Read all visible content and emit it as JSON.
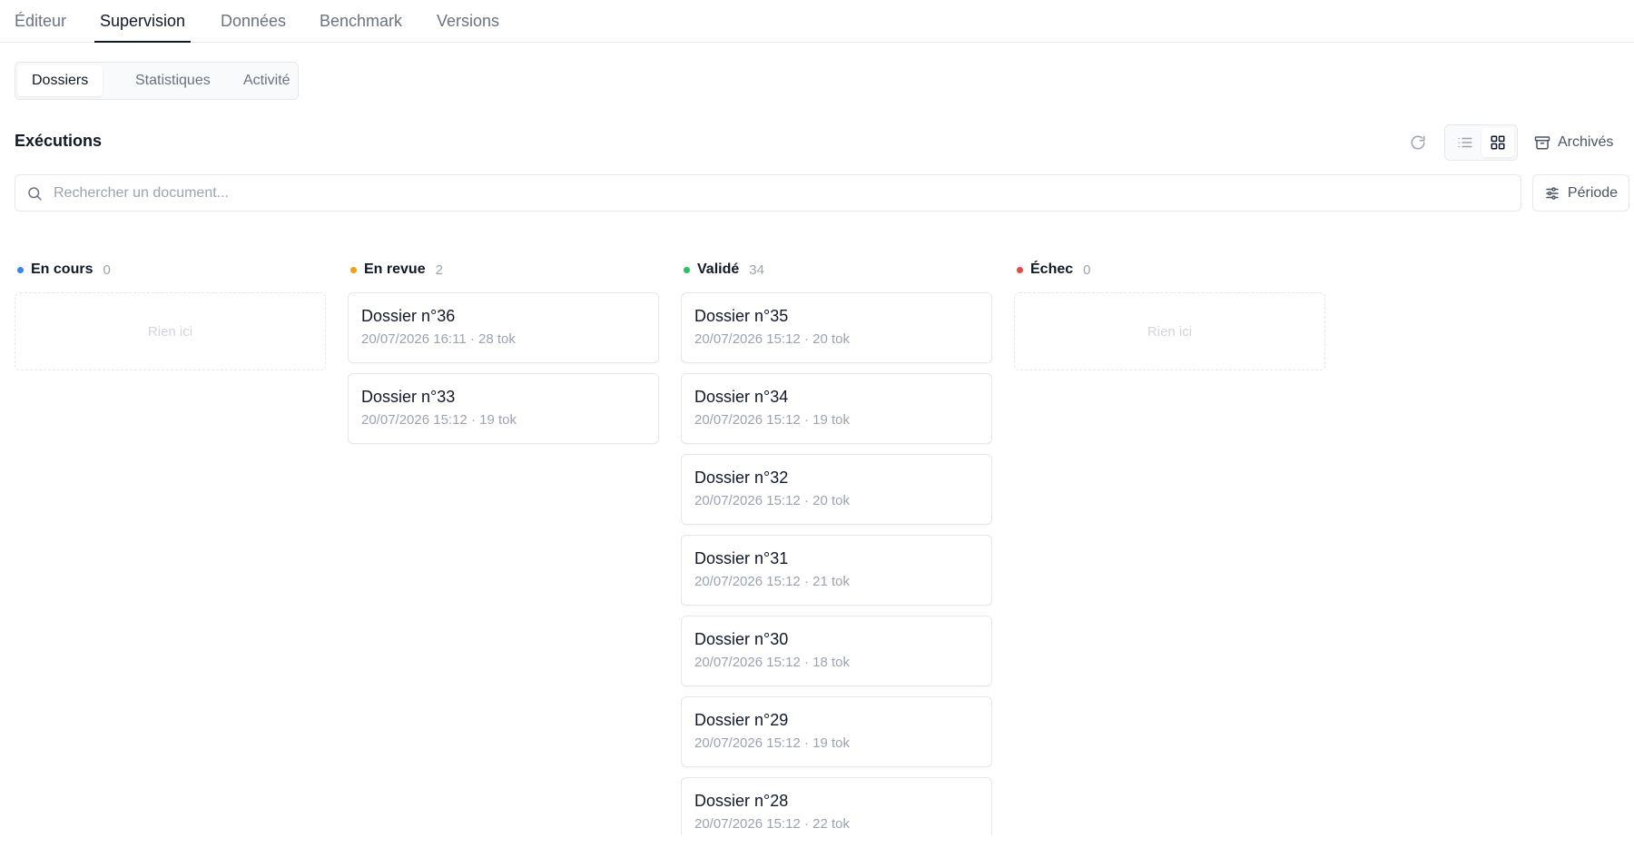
{
  "top_tabs": [
    "Éditeur",
    "Supervision",
    "Données",
    "Benchmark",
    "Versions"
  ],
  "active_top_tab": "Supervision",
  "sub_tabs": [
    "Dossiers",
    "Statistiques",
    "Activité"
  ],
  "active_sub_tab": "Dossiers",
  "section": {
    "title": "Exécutions",
    "archives_label": "Archivés",
    "view_mode": "grid"
  },
  "search": {
    "placeholder": "Rechercher un document...",
    "value": ""
  },
  "filter": {
    "periode_label": "Période"
  },
  "icons": {
    "refresh": "refresh-icon",
    "list_view": "list-icon",
    "grid_view": "grid-icon",
    "archive": "archive-icon",
    "search": "search-icon",
    "filter": "sliders-icon"
  },
  "columns": [
    {
      "title": "En cours",
      "count": "0",
      "color": "#3b82f6",
      "empty_label": "Rien ici",
      "cards": []
    },
    {
      "title": "En revue",
      "count": "2",
      "color": "#f59e0b",
      "empty_label": "",
      "cards": [
        {
          "title": "Dossier n°36",
          "meta": "20/07/2026 16:11 · 28 tok"
        },
        {
          "title": "Dossier n°33",
          "meta": "20/07/2026 15:12 · 19 tok"
        }
      ]
    },
    {
      "title": "Validé",
      "count": "34",
      "color": "#22c55e",
      "empty_label": "",
      "cards": [
        {
          "title": "Dossier n°35",
          "meta": "20/07/2026 15:12 · 20 tok"
        },
        {
          "title": "Dossier n°34",
          "meta": "20/07/2026 15:12 · 19 tok"
        },
        {
          "title": "Dossier n°32",
          "meta": "20/07/2026 15:12 · 20 tok"
        },
        {
          "title": "Dossier n°31",
          "meta": "20/07/2026 15:12 · 21 tok"
        },
        {
          "title": "Dossier n°30",
          "meta": "20/07/2026 15:12 · 18 tok"
        },
        {
          "title": "Dossier n°29",
          "meta": "20/07/2026 15:12 · 19 tok"
        },
        {
          "title": "Dossier n°28",
          "meta": "20/07/2026 15:12 · 22 tok"
        }
      ]
    },
    {
      "title": "Échec",
      "count": "0",
      "color": "#ef4444",
      "empty_label": "Rien ici",
      "cards": []
    }
  ]
}
